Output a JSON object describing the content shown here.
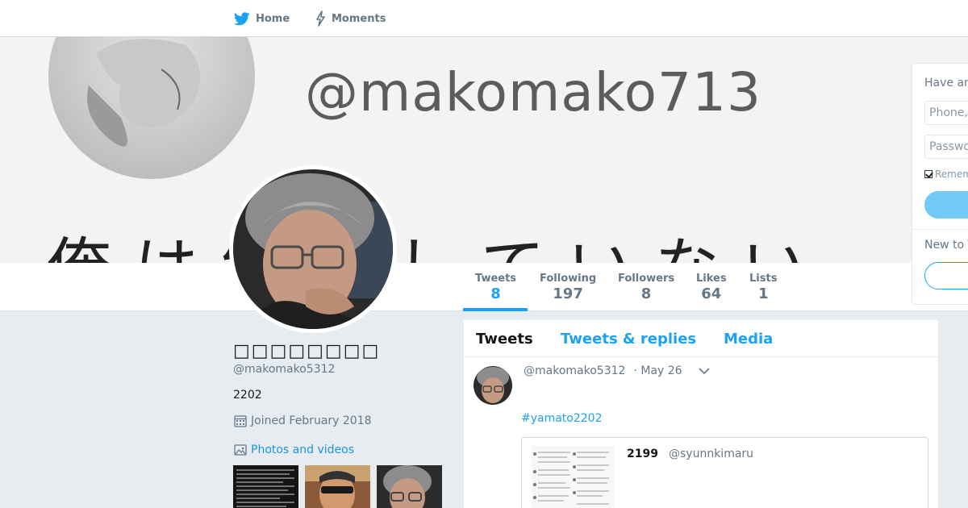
{
  "nav": {
    "home_label": "Home",
    "moments_label": "Moments"
  },
  "banner": {
    "handle_text": "@makomako713",
    "jp_text": "俺は納得していない"
  },
  "stats": [
    {
      "label": "Tweets",
      "value": "8"
    },
    {
      "label": "Following",
      "value": "197"
    },
    {
      "label": "Followers",
      "value": "8"
    },
    {
      "label": "Likes",
      "value": "64"
    },
    {
      "label": "Lists",
      "value": "1"
    }
  ],
  "profile": {
    "name": "□□□□□□□□",
    "handle": "@makomako5312",
    "bio": "2202",
    "joined": "Joined February 2018",
    "photos_link": "Photos and videos"
  },
  "timeline": {
    "tabs": [
      "Tweets",
      "Tweets & replies",
      "Media"
    ],
    "tweet": {
      "handle": "@makomako5312",
      "date": "· May 26",
      "hashtag": "#yamato2202",
      "quote": {
        "name": "2199",
        "handle": "@syunnkimaru"
      }
    }
  },
  "login": {
    "title": "Have an account?",
    "phone_placeholder": "Phone, email or username",
    "password_placeholder": "Password",
    "remember_label": "Remember me",
    "new_to": "New to Twitter?"
  },
  "colors": {
    "accent": "#1da1f2",
    "link": "#1b95e0",
    "background": "#e6ecf0"
  }
}
